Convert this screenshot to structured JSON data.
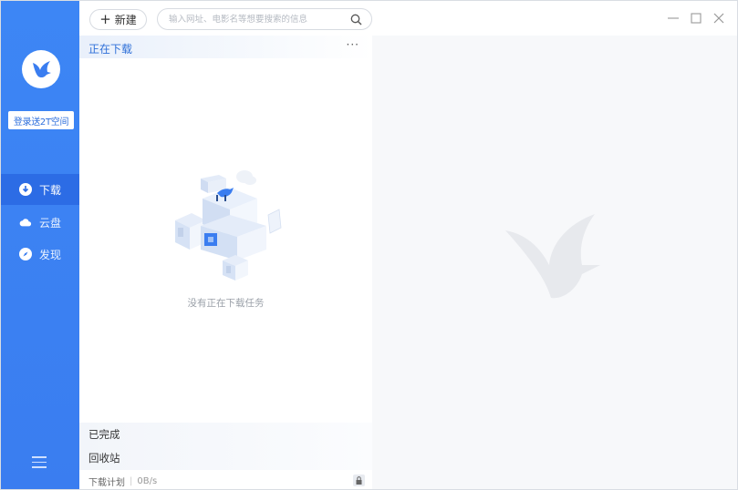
{
  "sidebar": {
    "login_label": "登录送2T空间",
    "nav": [
      {
        "label": "下载",
        "icon": "download-icon",
        "active": true
      },
      {
        "label": "云盘",
        "icon": "cloud-icon",
        "active": false
      },
      {
        "label": "发现",
        "icon": "compass-icon",
        "active": false
      }
    ]
  },
  "toolbar": {
    "new_label": "新建",
    "new_plus": "+",
    "search_placeholder": "输入网址、电影名等想要搜索的信息"
  },
  "list": {
    "downloading_title": "正在下载",
    "more_label": "···",
    "empty_text": "没有正在下载任务",
    "completed_label": "已完成",
    "recycle_label": "回收站",
    "plan_label": "下载计划",
    "speed": "0B/s"
  },
  "colors": {
    "sidebar": "#3a7df0",
    "active_nav": "#2c6ce5",
    "accent": "#2f70d8",
    "detail_bg": "#f7f8fa"
  }
}
